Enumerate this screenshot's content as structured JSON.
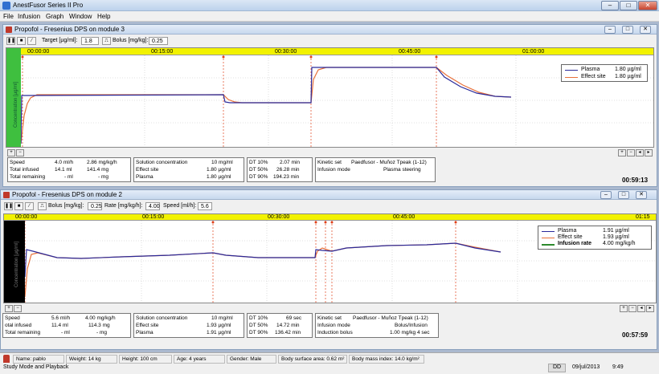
{
  "app": {
    "title": "AnestFusor Series II Pro"
  },
  "menu": [
    "File",
    "Infusion",
    "Graph",
    "Window",
    "Help"
  ],
  "win1": {
    "title": "Propofol - Fresenius DPS on module  3",
    "target_label": "Target [µg/ml]:",
    "target_value": "1.8",
    "bolus_label": "Bolus [mg/kg]:",
    "bolus_value": "0.25",
    "ylabel": "Concentration [µg/ml]",
    "time_ticks": [
      "00:00:00",
      "00:15:00",
      "00:30:00",
      "00:45:00",
      "01:00:00"
    ],
    "legend": [
      {
        "name": "Plasma",
        "value": "1.80 µg/ml",
        "color": "#2a2a9a"
      },
      {
        "name": "Effect site",
        "value": "1.80 µg/ml",
        "color": "#e8703a"
      }
    ],
    "info": {
      "speed": "Speed",
      "speed_v1": "4.0  ml/h",
      "speed_v2": "2.86  mg/kg/h",
      "total_inf": "Total infused",
      "total_inf_v1": "14.1  ml",
      "total_inf_v2": "141.4  mg",
      "total_rem": "Total remaining",
      "total_rem_v1": "-  ml",
      "total_rem_v2": "-  mg",
      "sol": "Solution concentration",
      "sol_v": "10  mg/ml",
      "eff": "Effect site",
      "eff_v": "1.80  µg/ml",
      "pla": "Plasma",
      "pla_v": "1.80  µg/ml",
      "dt10": "DT 10%",
      "dt10_v": "2.07  min",
      "dt50": "DT 50%",
      "dt50_v": "26.28  min",
      "dt90": "DT 90%",
      "dt90_v": "194.23  min",
      "kin": "Kinetic set",
      "kin_v": "Paedfusor - Muñoz Tpeak  (1-12)",
      "mode": "Infusion mode",
      "mode_v": "Plasma steering"
    },
    "time": "00:59:13"
  },
  "win2": {
    "title": "Propofol - Fresenius DPS on module  2",
    "bolus_label": "Bolus [mg/kg]:",
    "bolus_value": "0.25",
    "rate_label": "Rate [mg/kg/h]:",
    "rate_value": "4.00",
    "speed_label": "Speed [ml/h]:",
    "speed_value": "5.6",
    "ylabel": "Concentration [µg/ml]",
    "time_ticks": [
      "00:00:00",
      "00:15:00",
      "00:30:00",
      "00:45:00",
      "01:15"
    ],
    "legend": [
      {
        "name": "Plasma",
        "value": "1.91 µg/ml",
        "color": "#2a2a9a"
      },
      {
        "name": "Effect site",
        "value": "1.93 µg/ml",
        "color": "#e8703a"
      },
      {
        "name": "Infusion rate",
        "value": "4.00 mg/kg/h",
        "color": "#2d8a2d"
      }
    ],
    "info": {
      "speed": "Speed",
      "speed_v1": "5.6  ml/h",
      "speed_v2": "4.00  mg/kg/h",
      "total_inf": "otal infused",
      "total_inf_v1": "11.4  ml",
      "total_inf_v2": "114.3  mg",
      "total_rem": "Total remaining",
      "total_rem_v1": "-  ml",
      "total_rem_v2": "-  mg",
      "sol": "Solution concentration",
      "sol_v": "10  mg/ml",
      "eff": "Effect site",
      "eff_v": "1.93  µg/ml",
      "pla": "Plasma",
      "pla_v": "1.91  µg/ml",
      "dt10": "DT 10%",
      "dt10_v": "69  sec",
      "dt50": "DT 50%",
      "dt50_v": "14.72  min",
      "dt90": "DT 90%",
      "dt90_v": "136.42  min",
      "kin": "Kinetic set",
      "kin_v": "Paedfusor - Muñoz Tpeak  (1-12)",
      "mode": "Infusion mode",
      "mode_v": "Bolus/Infusion",
      "ind": "Induction bolus",
      "ind_v": "1.00 mg/kg 4 sec"
    },
    "time": "00:57:59"
  },
  "patient": {
    "name": "Name: pablo",
    "weight": "Weight: 14 kg",
    "height": "Height: 100 cm",
    "age": "Age: 4 years",
    "gender": "Gender: Male",
    "bsa": "Body surface area: 0.62 m²",
    "bmi": "Body mass index: 14.0 kg/m²"
  },
  "status": {
    "text": "Study Mode and Playback",
    "dd": "DD",
    "date": "09/jul/2013",
    "clock": "9:49"
  }
}
